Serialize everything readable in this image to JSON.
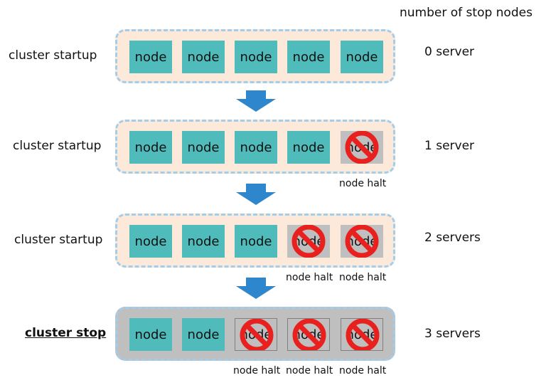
{
  "header": {
    "title": "number of stop nodes"
  },
  "node_label": "node",
  "halt_label": "node halt",
  "colors": {
    "node_active": "#4fbbbb",
    "node_halted": "#bfbfbf",
    "cluster_running_bg": "#fde9d9",
    "cluster_stopped_bg": "#bfbfbf",
    "cluster_border": "#a3cdec",
    "arrow": "#2e86cd",
    "ban": "#e8211f"
  },
  "rows": [
    {
      "label": "cluster startup",
      "count": "0 server",
      "state": "running",
      "nodes": [
        "active",
        "active",
        "active",
        "active",
        "active"
      ]
    },
    {
      "label": "cluster startup",
      "count": "1 server",
      "state": "running",
      "nodes": [
        "active",
        "active",
        "active",
        "active",
        "halted"
      ]
    },
    {
      "label": "cluster startup",
      "count": "2 servers",
      "state": "running",
      "nodes": [
        "active",
        "active",
        "active",
        "halted",
        "halted"
      ]
    },
    {
      "label": "cluster stop",
      "count": "3 servers",
      "state": "stopped",
      "nodes": [
        "active",
        "active",
        "halted",
        "halted",
        "halted"
      ]
    }
  ]
}
